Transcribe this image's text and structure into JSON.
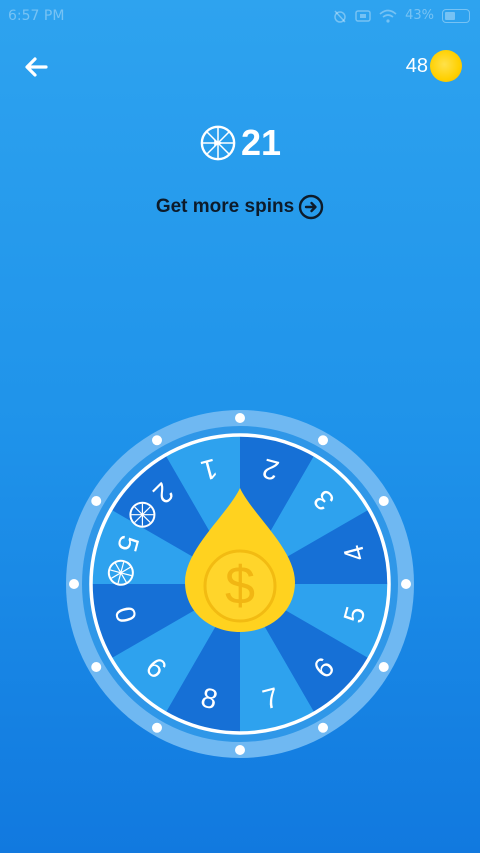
{
  "status_bar": {
    "time": "6:57 PM",
    "battery": "43%",
    "icons": [
      "alarm-off-icon",
      "sim-icon",
      "wifi-icon",
      "battery-icon"
    ]
  },
  "header": {
    "back_icon": "arrow-left-icon",
    "coin_count": "48",
    "coin_icon": "coin-icon"
  },
  "spins": {
    "icon": "wheel-icon",
    "count": "21",
    "get_more_label": "Get more spins",
    "get_more_icon": "arrow-circle-right-icon"
  },
  "wheel": {
    "segments": [
      {
        "label": "2"
      },
      {
        "label": "3"
      },
      {
        "label": "4"
      },
      {
        "label": "5"
      },
      {
        "label": "6"
      },
      {
        "label": "7"
      },
      {
        "label": "8"
      },
      {
        "label": "6"
      },
      {
        "label": "0"
      },
      {
        "label": "5",
        "icon": "wheel-icon"
      },
      {
        "label": "2",
        "icon": "wheel-icon"
      },
      {
        "label": "1"
      }
    ],
    "center_symbol": "$",
    "colors": {
      "dark": "#1670d6",
      "light": "#2ea2ee",
      "outer": "#6fb8f2",
      "pointer": "#ffd21f"
    }
  }
}
